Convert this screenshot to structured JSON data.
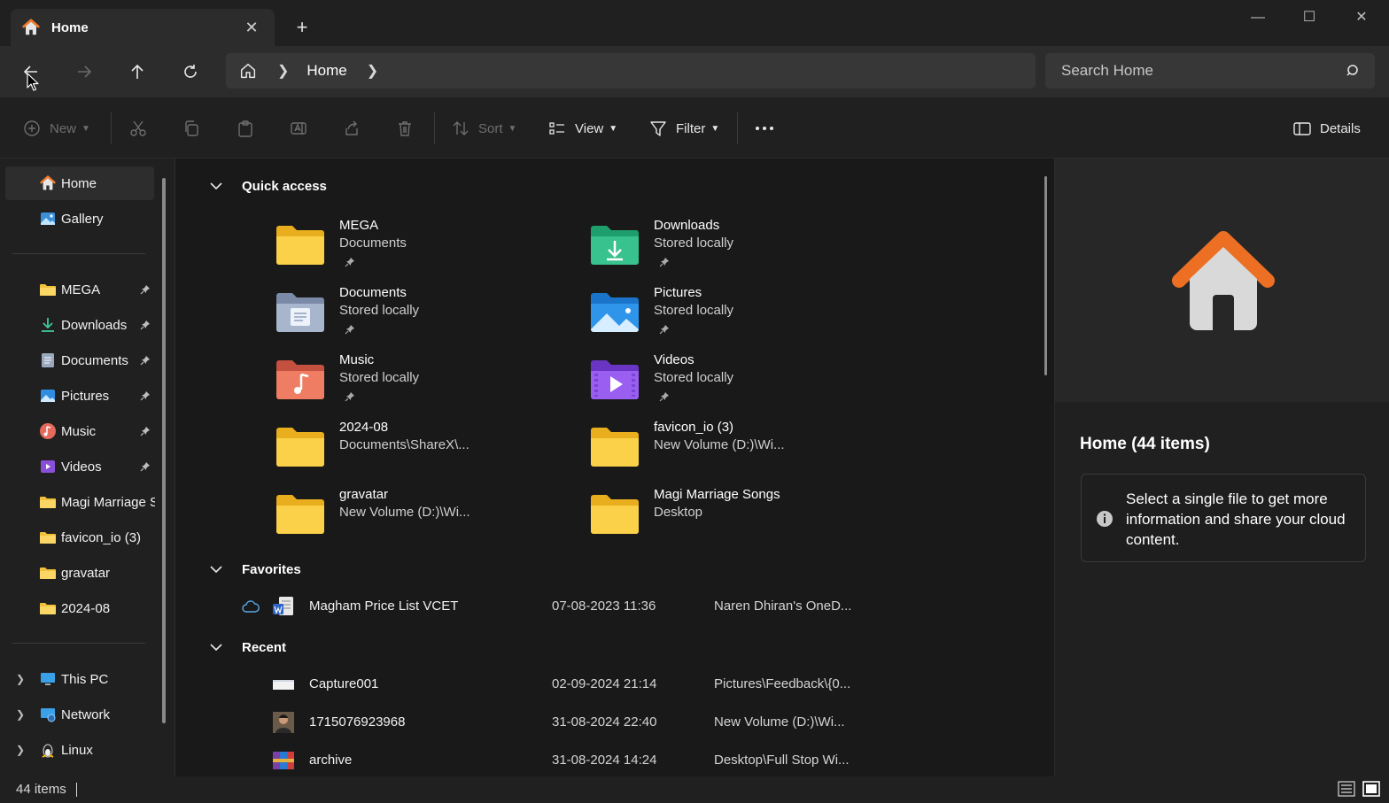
{
  "tab": {
    "title": "Home",
    "icon": "home-icon"
  },
  "window_controls": {
    "minimize": "minimize-icon",
    "maximize": "maximize-icon",
    "close": "close-icon"
  },
  "address": {
    "crumb": "Home"
  },
  "search": {
    "placeholder": "Search Home"
  },
  "commands": {
    "new_label": "New",
    "sort_label": "Sort",
    "view_label": "View",
    "filter_label": "Filter",
    "details_label": "Details"
  },
  "sidebar": {
    "items": [
      {
        "label": "Home",
        "icon": "home-icon"
      },
      {
        "label": "Gallery",
        "icon": "gallery-icon"
      },
      {
        "label": "MEGA",
        "icon": "folder-icon",
        "pinned": true
      },
      {
        "label": "Downloads",
        "icon": "downloads-icon",
        "pinned": true
      },
      {
        "label": "Documents",
        "icon": "documents-icon",
        "pinned": true
      },
      {
        "label": "Pictures",
        "icon": "pictures-icon",
        "pinned": true
      },
      {
        "label": "Music",
        "icon": "music-icon",
        "pinned": true
      },
      {
        "label": "Videos",
        "icon": "videos-icon",
        "pinned": true
      },
      {
        "label": "Magi Marriage Songs",
        "icon": "folder-icon"
      },
      {
        "label": "favicon_io (3)",
        "icon": "folder-icon"
      },
      {
        "label": "gravatar",
        "icon": "folder-icon"
      },
      {
        "label": "2024-08",
        "icon": "folder-icon"
      },
      {
        "label": "This PC",
        "icon": "pc-icon"
      },
      {
        "label": "Network",
        "icon": "network-icon"
      },
      {
        "label": "Linux",
        "icon": "linux-icon"
      }
    ]
  },
  "quick_access": {
    "title": "Quick access",
    "items": [
      {
        "name": "MEGA",
        "sub": "Documents",
        "pinned": true,
        "icon": "folder-icon"
      },
      {
        "name": "Downloads",
        "sub": "Stored locally",
        "pinned": true,
        "icon": "downloads-folder-icon"
      },
      {
        "name": "Documents",
        "sub": "Stored locally",
        "pinned": true,
        "icon": "documents-folder-icon"
      },
      {
        "name": "Pictures",
        "sub": "Stored locally",
        "pinned": true,
        "icon": "pictures-folder-icon"
      },
      {
        "name": "Music",
        "sub": "Stored locally",
        "pinned": true,
        "icon": "music-folder-icon"
      },
      {
        "name": "Videos",
        "sub": "Stored locally",
        "pinned": true,
        "icon": "videos-folder-icon"
      },
      {
        "name": "2024-08",
        "sub": "Documents\\ShareX\\...",
        "pinned": false,
        "icon": "folder-icon"
      },
      {
        "name": "favicon_io (3)",
        "sub": "New Volume (D:)\\Wi...",
        "pinned": false,
        "icon": "folder-icon"
      },
      {
        "name": "gravatar",
        "sub": "New Volume (D:)\\Wi...",
        "pinned": false,
        "icon": "folder-icon"
      },
      {
        "name": "Magi Marriage Songs",
        "sub": "Desktop",
        "pinned": false,
        "icon": "folder-icon"
      }
    ]
  },
  "favorites": {
    "title": "Favorites",
    "rows": [
      {
        "name": "Magham Price List VCET",
        "date": "07-08-2023 11:36",
        "location": "Naren Dhiran's OneD...",
        "icon": "word-doc-icon"
      }
    ]
  },
  "recent": {
    "title": "Recent",
    "rows": [
      {
        "name": "Capture001",
        "date": "02-09-2024 21:14",
        "location": "Pictures\\Feedback\\{0...",
        "icon": "image-thumbnail-icon"
      },
      {
        "name": "1715076923968",
        "date": "31-08-2024 22:40",
        "location": "New Volume (D:)\\Wi...",
        "icon": "photo-thumbnail-icon"
      },
      {
        "name": "archive",
        "date": "31-08-2024 14:24",
        "location": "Desktop\\Full Stop Wi...",
        "icon": "archive-icon"
      }
    ]
  },
  "details_pane": {
    "title": "Home (44 items)",
    "info": "Select a single file to get more information and share your cloud content."
  },
  "status": {
    "count": "44 items"
  },
  "colors": {
    "accent": "#ea6a1f",
    "folder": "#f5c842",
    "background": "#191919"
  }
}
